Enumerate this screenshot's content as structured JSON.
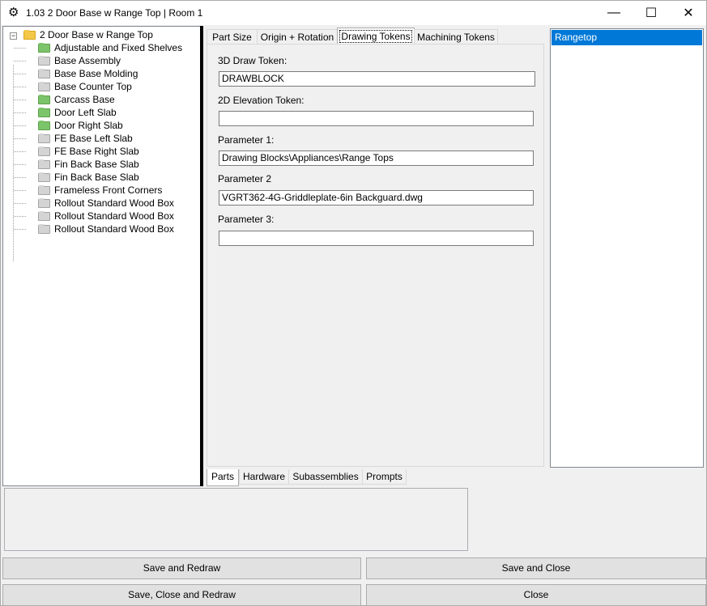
{
  "window": {
    "title": "1.03 2 Door Base w Range Top | Room 1",
    "controls": {
      "minimize": "—",
      "maximize": "☐",
      "close": "✕"
    }
  },
  "tree": {
    "root": {
      "label": "2 Door Base w Range Top",
      "icon": "folder-open-icon",
      "expander": "−"
    },
    "children": [
      {
        "label": "Adjustable and Fixed Shelves",
        "color": "green"
      },
      {
        "label": "Base Assembly",
        "color": "gray"
      },
      {
        "label": "Base Base Molding",
        "color": "gray"
      },
      {
        "label": "Base Counter Top",
        "color": "gray"
      },
      {
        "label": "Carcass Base",
        "color": "green"
      },
      {
        "label": "Door Left Slab",
        "color": "green"
      },
      {
        "label": "Door Right Slab",
        "color": "green"
      },
      {
        "label": "FE Base Left Slab",
        "color": "gray"
      },
      {
        "label": "FE Base Right Slab",
        "color": "gray"
      },
      {
        "label": "Fin Back Base Slab",
        "color": "gray"
      },
      {
        "label": "Fin Back Base Slab",
        "color": "gray"
      },
      {
        "label": "Frameless Front Corners",
        "color": "gray"
      },
      {
        "label": "Rollout Standard Wood Box",
        "color": "gray"
      },
      {
        "label": "Rollout Standard Wood Box",
        "color": "gray"
      },
      {
        "label": "Rollout Standard Wood Box",
        "color": "gray"
      }
    ]
  },
  "tabs": [
    {
      "label": "Part  Size",
      "active": false
    },
    {
      "label": "Origin + Rotation",
      "active": false
    },
    {
      "label": "Drawing Tokens",
      "active": true
    },
    {
      "label": "Machining Tokens",
      "active": false
    }
  ],
  "form": {
    "token3d_label": "3D Draw Token:",
    "token3d_value": "DRAWBLOCK",
    "elev2d_label": "2D Elevation Token:",
    "elev2d_value": "",
    "param1_label": "Parameter 1:",
    "param1_value": "Drawing Blocks\\Appliances\\Range Tops",
    "param2_label": "Parameter 2",
    "param2_value": "VGRT362-4G-Griddleplate-6in Backguard.dwg",
    "param3_label": "Parameter 3:",
    "param3_value": ""
  },
  "list": {
    "items": [
      "Rangetop"
    ]
  },
  "bottom_tabs": [
    {
      "label": "Parts",
      "active": true
    },
    {
      "label": "Hardware",
      "active": false
    },
    {
      "label": "Subassemblies",
      "active": false
    },
    {
      "label": "Prompts",
      "active": false
    }
  ],
  "buttons": {
    "save_redraw": "Save and Redraw",
    "save_close": "Save and Close",
    "save_close_redraw": "Save, Close and Redraw",
    "close": "Close"
  },
  "colors": {
    "selection": "#0078d7",
    "folder_green": "#7cc46a",
    "folder_gray": "#d4d4d4",
    "folder_open": "#f3c747"
  }
}
